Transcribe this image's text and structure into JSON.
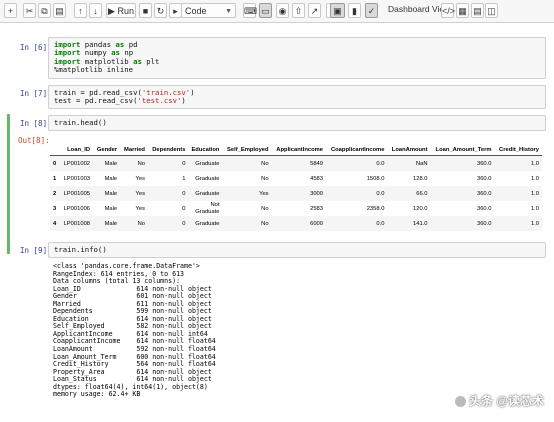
{
  "toolbar": {
    "run_label": "Run",
    "cell_type": "Code",
    "dashboard_label": "Dashboard View:"
  },
  "cells": {
    "c6": {
      "prompt": "In [6]:",
      "lines": [
        [
          {
            "t": "import",
            "c": "kw"
          },
          {
            "t": " pandas "
          },
          {
            "t": "as",
            "c": "kw"
          },
          {
            "t": " pd"
          }
        ],
        [
          {
            "t": "import",
            "c": "kw"
          },
          {
            "t": " numpy "
          },
          {
            "t": "as",
            "c": "kw"
          },
          {
            "t": " np"
          }
        ],
        [
          {
            "t": "import",
            "c": "kw"
          },
          {
            "t": " matplotlib "
          },
          {
            "t": "as",
            "c": "kw"
          },
          {
            "t": " plt"
          }
        ],
        [
          {
            "t": "%matplotlib inline"
          }
        ]
      ]
    },
    "c7": {
      "prompt": "In [7]:",
      "lines": [
        [
          {
            "t": "train = pd.read_csv("
          },
          {
            "t": "'train.csv'",
            "c": "str"
          },
          {
            "t": ")"
          }
        ],
        [
          {
            "t": "test = pd.read_csv("
          },
          {
            "t": "'test.csv'",
            "c": "str"
          },
          {
            "t": ")"
          }
        ]
      ]
    },
    "c8": {
      "prompt_in": "In [8]:",
      "prompt_out": "Out[8]:",
      "code": "train.head()",
      "table": {
        "columns": [
          "",
          "Loan_ID",
          "Gender",
          "Married",
          "Dependents",
          "Education",
          "Self_Employed",
          "ApplicantIncome",
          "CoapplicantIncome",
          "LoanAmount",
          "Loan_Amount_Term",
          "Credit_History"
        ],
        "rows": [
          [
            "0",
            "LP001002",
            "Male",
            "No",
            "0",
            "Graduate",
            "No",
            "5849",
            "0.0",
            "NaN",
            "360.0",
            "1.0"
          ],
          [
            "1",
            "LP001003",
            "Male",
            "Yes",
            "1",
            "Graduate",
            "No",
            "4583",
            "1508.0",
            "128.0",
            "360.0",
            "1.0"
          ],
          [
            "2",
            "LP001005",
            "Male",
            "Yes",
            "0",
            "Graduate",
            "Yes",
            "3000",
            "0.0",
            "66.0",
            "360.0",
            "1.0"
          ],
          [
            "3",
            "LP001006",
            "Male",
            "Yes",
            "0",
            "Not Graduate",
            "No",
            "2583",
            "2358.0",
            "120.0",
            "360.0",
            "1.0"
          ],
          [
            "4",
            "LP001008",
            "Male",
            "No",
            "0",
            "Graduate",
            "No",
            "6000",
            "0.0",
            "141.0",
            "360.0",
            "1.0"
          ]
        ]
      }
    },
    "c9": {
      "prompt": "In [9]:",
      "code": "train.info()",
      "output": "<class 'pandas.core.frame.DataFrame'>\nRangeIndex: 614 entries, 0 to 613\nData columns (total 13 columns):\nLoan_ID              614 non-null object\nGender               601 non-null object\nMarried              611 non-null object\nDependents           599 non-null object\nEducation            614 non-null object\nSelf_Employed        582 non-null object\nApplicantIncome      614 non-null int64\nCoapplicantIncome    614 non-null float64\nLoanAmount           592 non-null float64\nLoan_Amount_Term     600 non-null float64\nCredit_History       564 non-null float64\nProperty_Area        614 non-null object\nLoan_Status          614 non-null object\ndtypes: float64(4), int64(1), object(8)\nmemory usage: 62.4+ KB"
    }
  },
  "watermark": "头条 @读芯术",
  "colors": {
    "prompt_in": "#303f9f",
    "prompt_out": "#d84315",
    "selected_cell_bar": "#66bb6a",
    "keyword": "#008000",
    "string": "#ba2121"
  }
}
